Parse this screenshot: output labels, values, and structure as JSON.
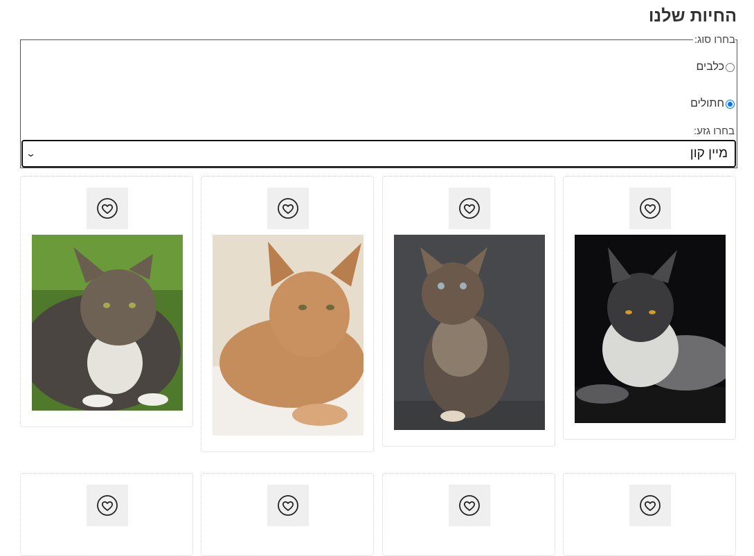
{
  "page": {
    "title": "החיות שלנו"
  },
  "filter": {
    "type_legend": "בחרו סוג:",
    "options": [
      {
        "label": "כלבים",
        "checked": false
      },
      {
        "label": "חתולים",
        "checked": true
      }
    ],
    "breed_label": "בחרו גזע:",
    "breed_selected": "מיין קון"
  },
  "cards": [
    {
      "fav_icon": "heart-icon",
      "image": "black-smoke-maine-coon-cat"
    },
    {
      "fav_icon": "heart-icon",
      "image": "tortoiseshell-maine-coon-kitten"
    },
    {
      "fav_icon": "heart-icon",
      "image": "red-tabby-maine-coon-cat"
    },
    {
      "fav_icon": "heart-icon",
      "image": "brown-tabby-maine-coon-on-grass"
    },
    {
      "fav_icon": "heart-icon"
    },
    {
      "fav_icon": "heart-icon"
    },
    {
      "fav_icon": "heart-icon"
    },
    {
      "fav_icon": "heart-icon"
    }
  ],
  "colors": {
    "accent": "#0075ff",
    "favorite_bg": "#efefef"
  }
}
